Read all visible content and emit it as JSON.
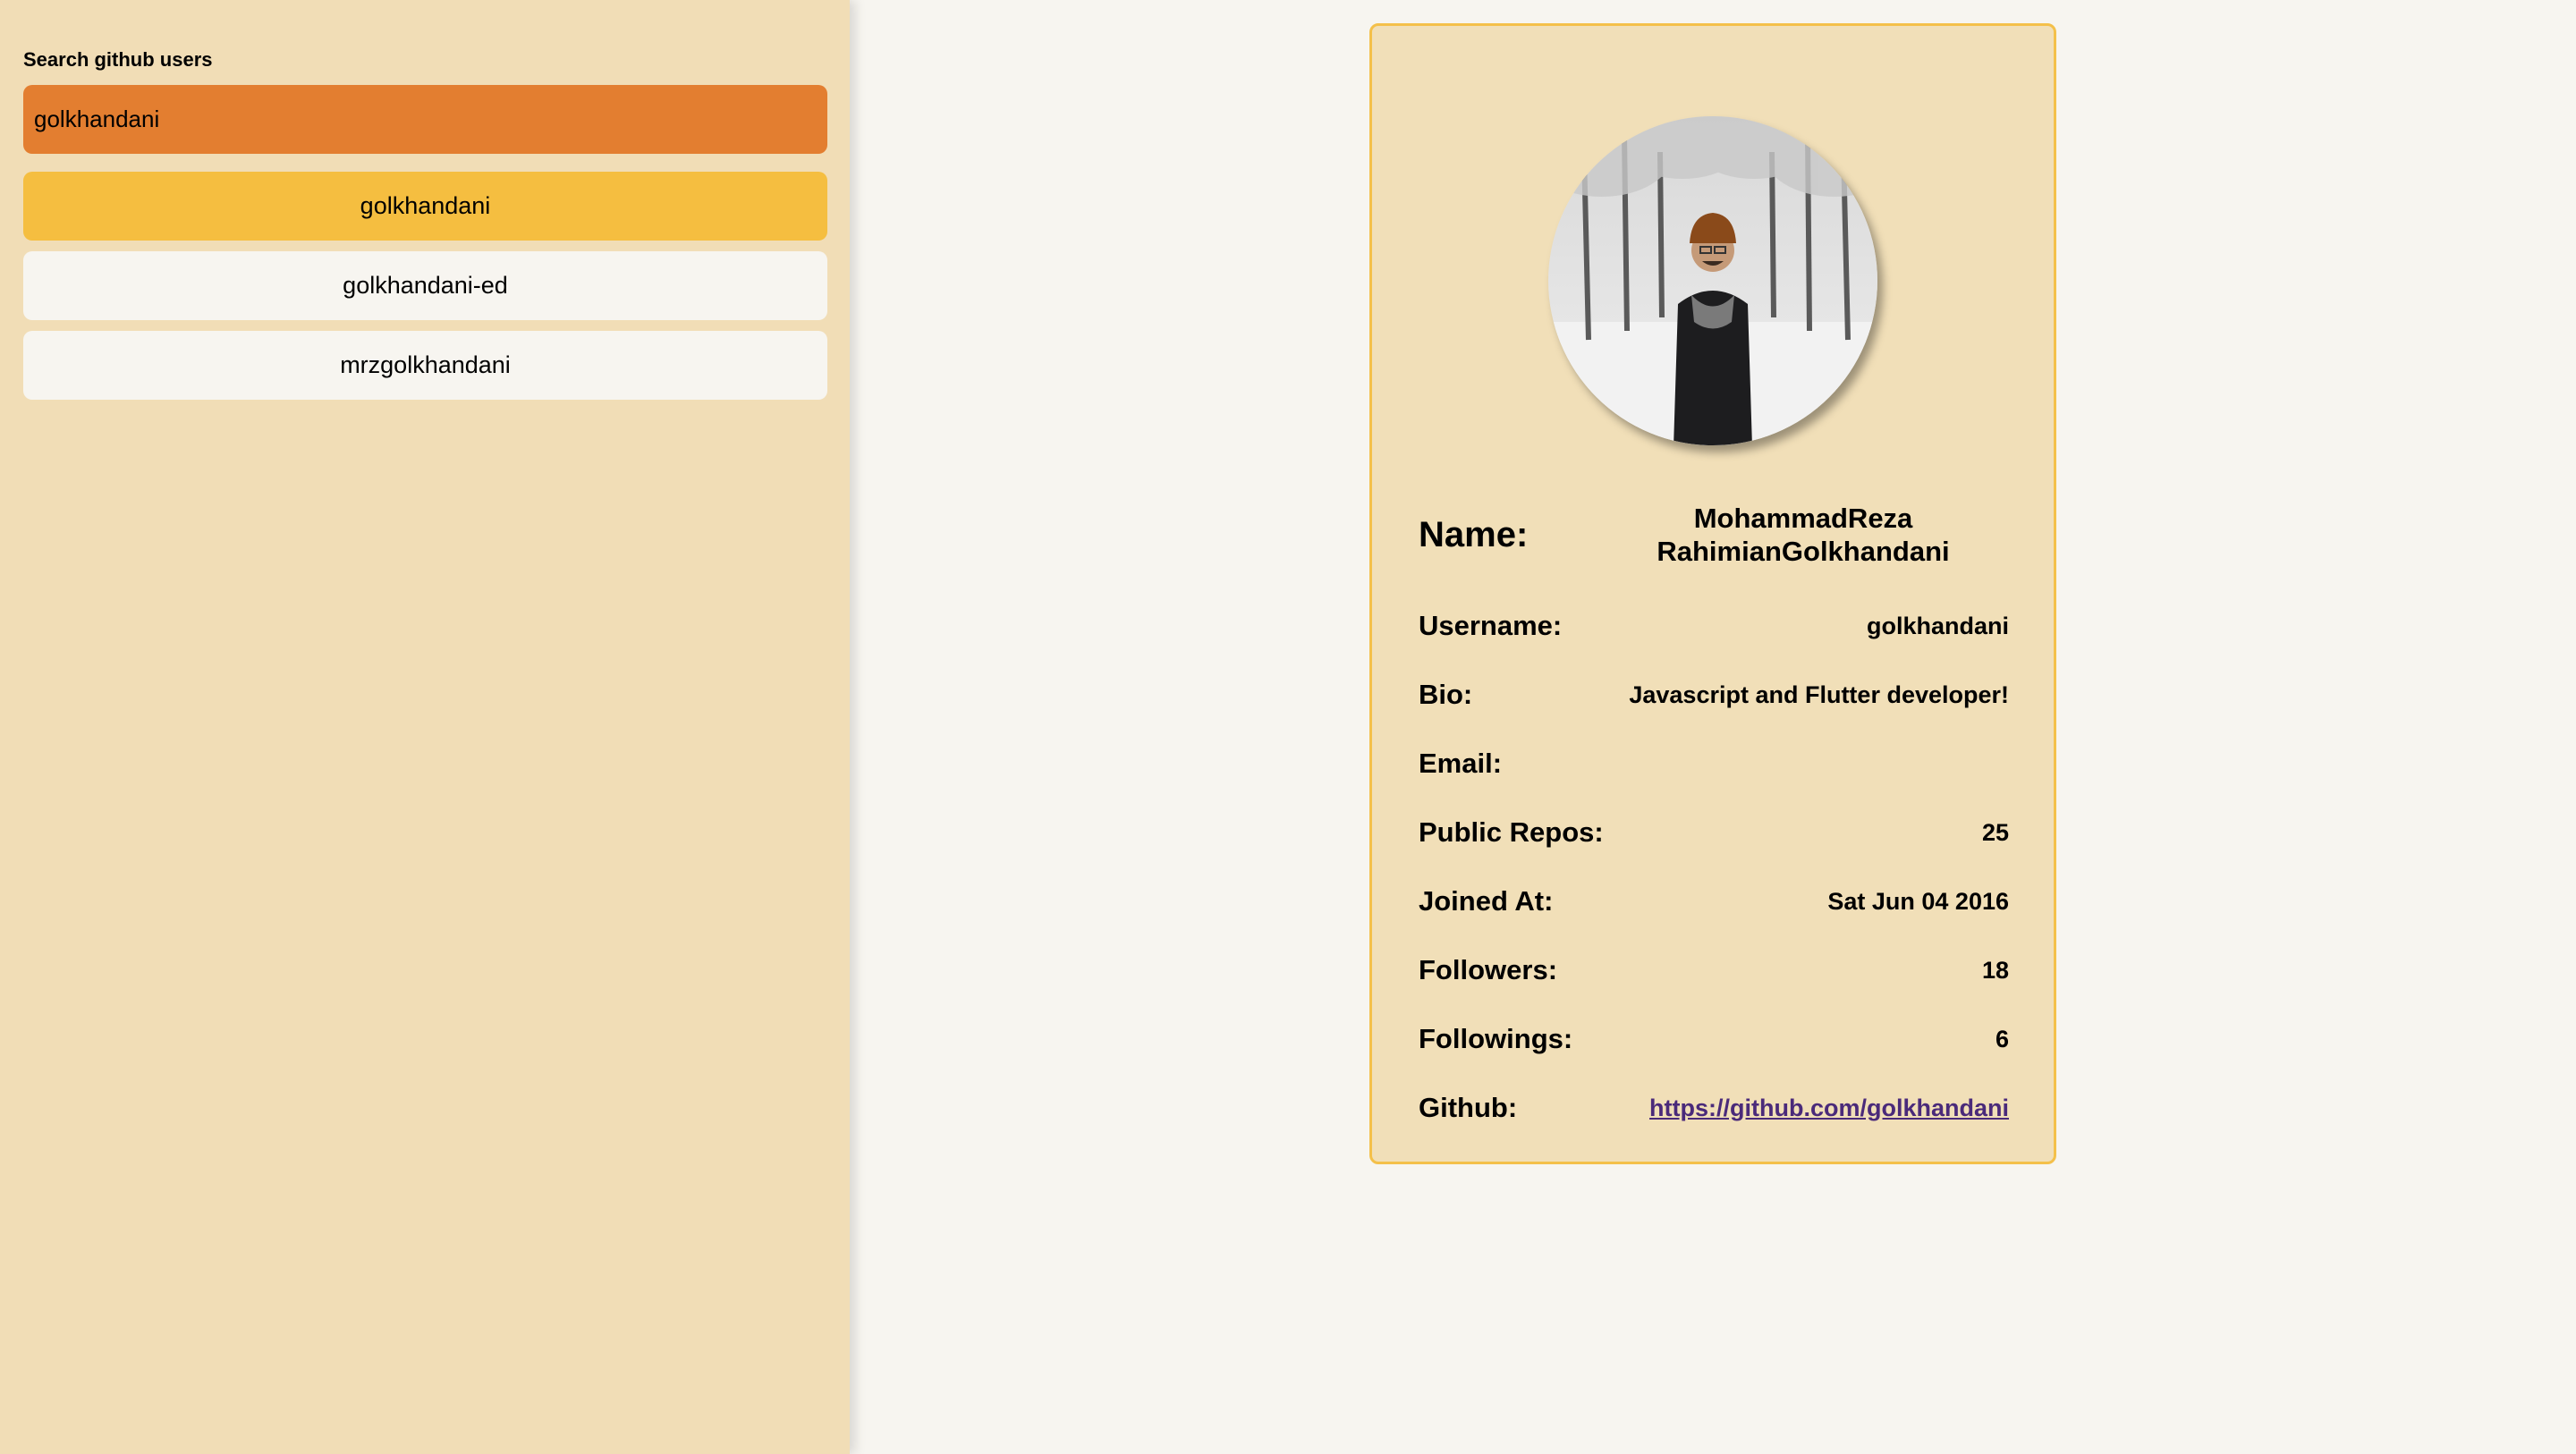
{
  "sidebar": {
    "search_label": "Search github users",
    "search_value": "golkhandani",
    "results": [
      {
        "label": "golkhandani",
        "selected": true
      },
      {
        "label": "golkhandani-ed",
        "selected": false
      },
      {
        "label": "mrzgolkhandani",
        "selected": false
      }
    ]
  },
  "profile": {
    "avatar_icon": "profile-photo",
    "name_label": "Name:",
    "name_line1": "MohammadReza",
    "name_line2": "RahimianGolkhandani",
    "username_label": "Username:",
    "username": "golkhandani",
    "bio_label": "Bio:",
    "bio": "Javascript and Flutter developer!",
    "email_label": "Email:",
    "email": "",
    "repos_label": "Public Repos:",
    "repos": "25",
    "joined_label": "Joined At:",
    "joined": "Sat Jun 04 2016",
    "followers_label": "Followers:",
    "followers": "18",
    "followings_label": "Followings:",
    "followings": "6",
    "github_label": "Github:",
    "github_url": "https://github.com/golkhandani"
  },
  "colors": {
    "sidebar_bg": "#f1ddb6",
    "search_bg": "#e37e30",
    "selected_bg": "#f5be40",
    "card_border": "#f4c04a",
    "page_bg": "#f7f5f0"
  }
}
